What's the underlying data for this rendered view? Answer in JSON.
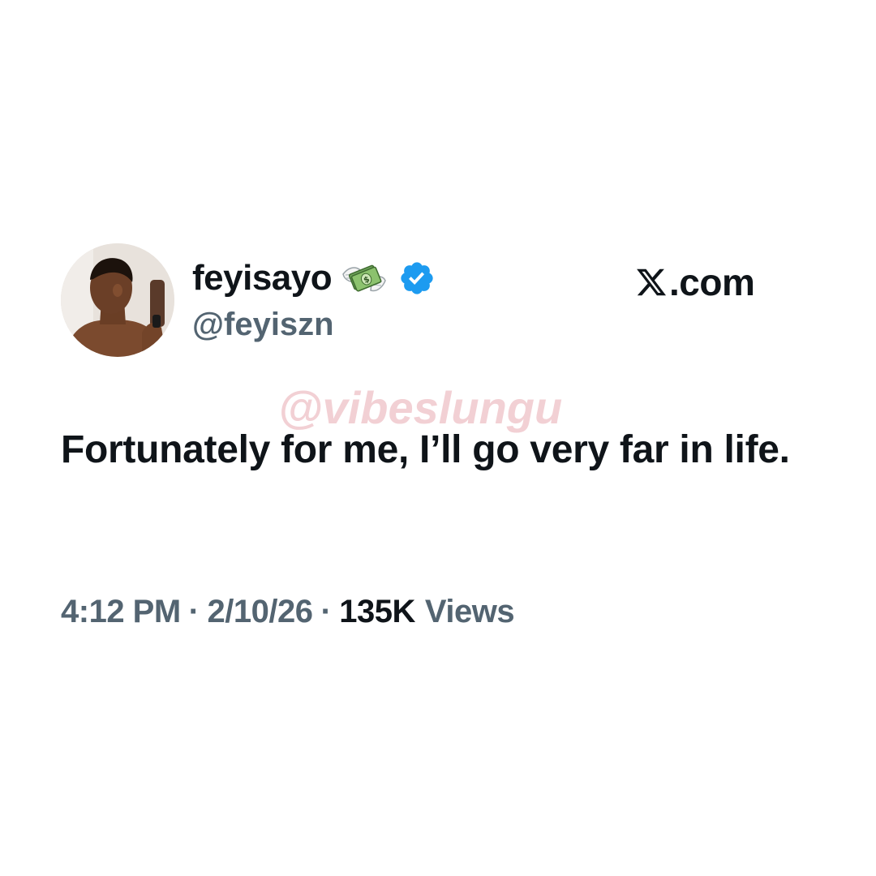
{
  "tweet": {
    "author": {
      "display_name": "feyisayo",
      "display_name_emoji": "money-with-wings-icon",
      "verified": true,
      "verified_badge_color": "#1d9bf0",
      "handle": "@feyiszn"
    },
    "platform_label": ".com",
    "platform_icon": "x-logo-icon",
    "watermark": "@vibeslungu",
    "text": "Fortunately for me, I’ll go very far in life.",
    "meta": {
      "time": "4:12 PM",
      "separator": "·",
      "date": "2/10/26",
      "view_count": "135K",
      "views_label": "Views"
    }
  },
  "colors": {
    "primary_text": "#0f1419",
    "secondary_text": "#536471",
    "background": "#ffffff",
    "watermark": "#e8aab0"
  }
}
